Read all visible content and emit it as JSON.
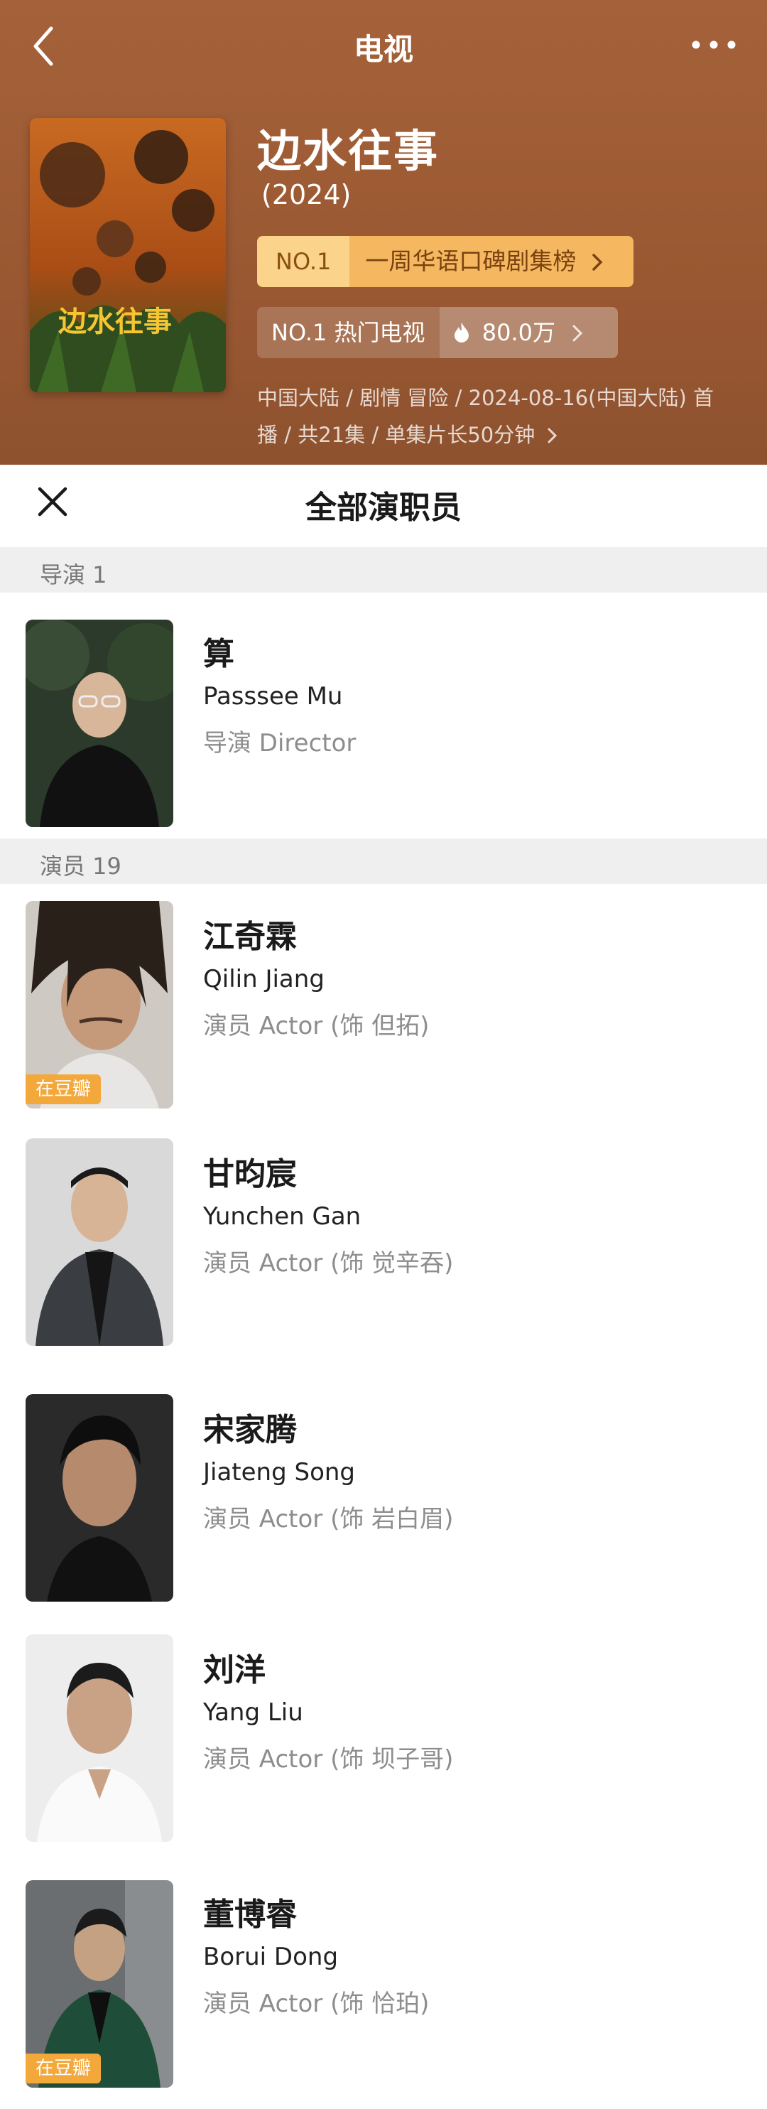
{
  "header": {
    "title": "电视"
  },
  "movie": {
    "title": "边水往事",
    "year": "(2024)",
    "rank1_no": "NO.1",
    "rank1_label": "一周华语口碑剧集榜",
    "rank2_label": "NO.1 热门电视",
    "hot_value": "80.0万",
    "meta_line1": "中国大陆 / 剧情 冒险 / 2024-08-16(中国大陆) 首",
    "meta_line2": "播 / 共21集 / 单集片长50分钟",
    "poster_title": "边水往事"
  },
  "sheet": {
    "title": "全部演职员"
  },
  "sections": {
    "director": "导演 1",
    "actors": "演员 19"
  },
  "director": {
    "name": "算",
    "en": "Passsee Mu",
    "role": "导演 Director"
  },
  "actors": [
    {
      "name": "江奇霖",
      "en": "Qilin Jiang",
      "role": "演员 Actor (饰 但拓)",
      "badge": "在豆瓣"
    },
    {
      "name": "甘昀宸",
      "en": "Yunchen Gan",
      "role": "演员 Actor (饰 觉辛吞)"
    },
    {
      "name": "宋家腾",
      "en": "Jiateng Song",
      "role": "演员 Actor (饰 岩白眉)"
    },
    {
      "name": "刘洋",
      "en": "Yang Liu",
      "role": "演员 Actor (饰 坝子哥)"
    },
    {
      "name": "董博睿",
      "en": "Borui Dong",
      "role": "演员 Actor (饰 恰珀)",
      "badge": "在豆瓣"
    }
  ],
  "colors": {
    "hero_bg": "#9a5832",
    "rank_gold": "#f5b860",
    "badge": "#f3a83b"
  }
}
